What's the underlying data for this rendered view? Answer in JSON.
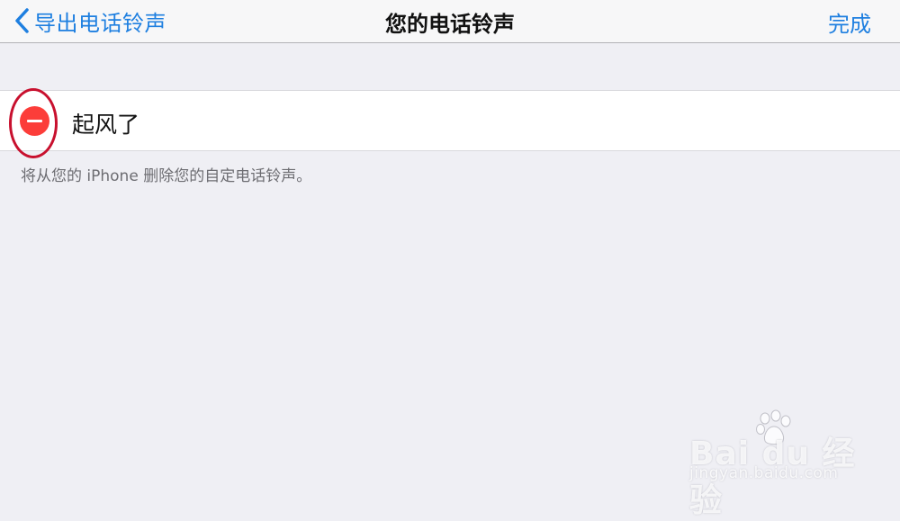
{
  "navbar": {
    "back_label": "导出电话铃声",
    "title": "您的电话铃声",
    "done_label": "完成"
  },
  "ringtones": [
    {
      "name": "起风了"
    }
  ],
  "footer_note": "将从您的 iPhone 删除您的自定电话铃声。",
  "watermark": {
    "brand": "Bai du 经验",
    "url": "jingyan.baidu.com"
  },
  "colors": {
    "accent": "#1e7fe0",
    "delete": "#fc3d39",
    "highlight_ring": "#c8102e",
    "background": "#efeff4"
  }
}
